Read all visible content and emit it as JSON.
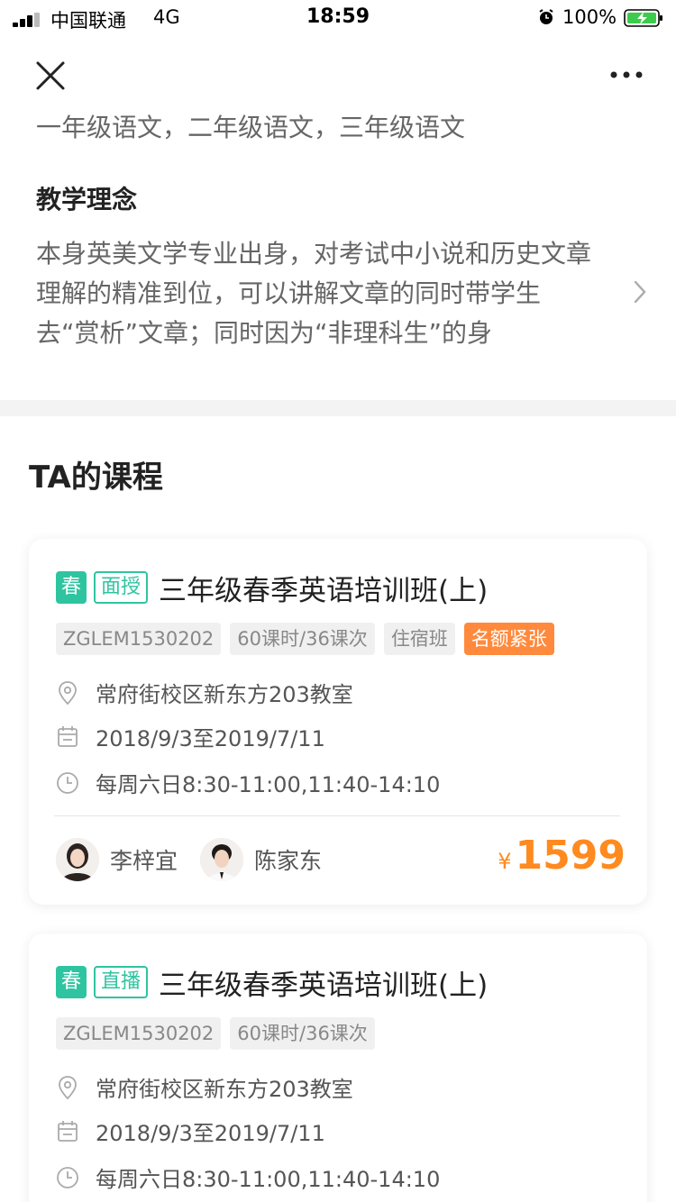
{
  "status_bar": {
    "carrier": "中国联通",
    "network": "4G",
    "time": "18:59",
    "battery_percent": "100%"
  },
  "profile": {
    "subjects": "一年级语文，二年级语文，三年级语文",
    "philosophy_title": "教学理念",
    "philosophy_text": "本身英美文学专业出身，对考试中小说和历史文章理解的精准到位，可以讲解文章的同时带学生去“赏析”文章；同时因为“非理科生”的身"
  },
  "courses_title": "TA的课程",
  "courses": [
    {
      "season": "春",
      "mode": "面授",
      "name": "三年级春季英语培训班(上)",
      "code": "ZGLEM1530202",
      "hours": "60课时/36课次",
      "type": "住宿班",
      "status": "名额紧张",
      "location": "常府街校区新东方203教室",
      "date_range": "2018/9/3至2019/7/11",
      "schedule": "每周六日8:30-11:00,11:40-14:10",
      "teachers": [
        "李梓宜",
        "陈家东"
      ],
      "currency": "¥",
      "price": "1599"
    },
    {
      "season": "春",
      "mode": "直播",
      "name": "三年级春季英语培训班(上)",
      "code": "ZGLEM1530202",
      "hours": "60课时/36课次",
      "location": "常府街校区新东方203教室",
      "date_range": "2018/9/3至2019/7/11",
      "schedule": "每周六日8:30-11:00,11:40-14:10"
    }
  ],
  "colors": {
    "accent_green": "#2ec4a0",
    "price_orange": "#ff8a1f",
    "hot_badge": "#ff8a3d"
  }
}
